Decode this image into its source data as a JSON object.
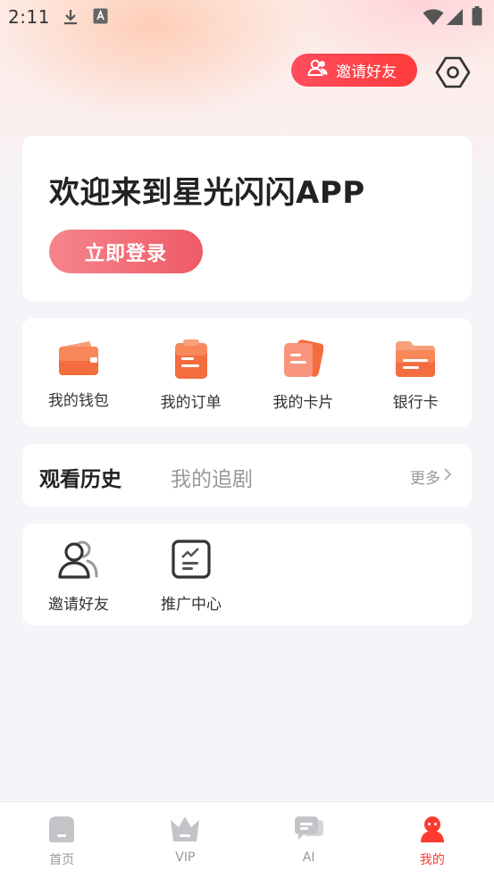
{
  "status_bar": {
    "time": "2:11"
  },
  "header": {
    "invite_label": "邀请好友"
  },
  "welcome": {
    "title": "欢迎来到星光闪闪APP",
    "login_label": "立即登录"
  },
  "quick_actions": [
    {
      "label": "我的钱包",
      "icon": "wallet-icon"
    },
    {
      "label": "我的订单",
      "icon": "order-icon"
    },
    {
      "label": "我的卡片",
      "icon": "card-icon"
    },
    {
      "label": "银行卡",
      "icon": "bank-card-icon"
    }
  ],
  "history": {
    "tab_active": "观看历史",
    "tab_other": "我的追剧",
    "more_label": "更多"
  },
  "tools": [
    {
      "label": "邀请好友",
      "icon": "invite-friends-icon"
    },
    {
      "label": "推广中心",
      "icon": "promotion-center-icon"
    }
  ],
  "tabbar": [
    {
      "label": "首页",
      "icon": "home-icon"
    },
    {
      "label": "VIP",
      "icon": "crown-icon"
    },
    {
      "label": "AI",
      "icon": "chat-icon"
    },
    {
      "label": "我的",
      "icon": "profile-icon",
      "active": true
    }
  ],
  "colors": {
    "accent": "#ff3b30",
    "login_button": "#ee5b66",
    "invite_pill": "#ff4d5e"
  }
}
